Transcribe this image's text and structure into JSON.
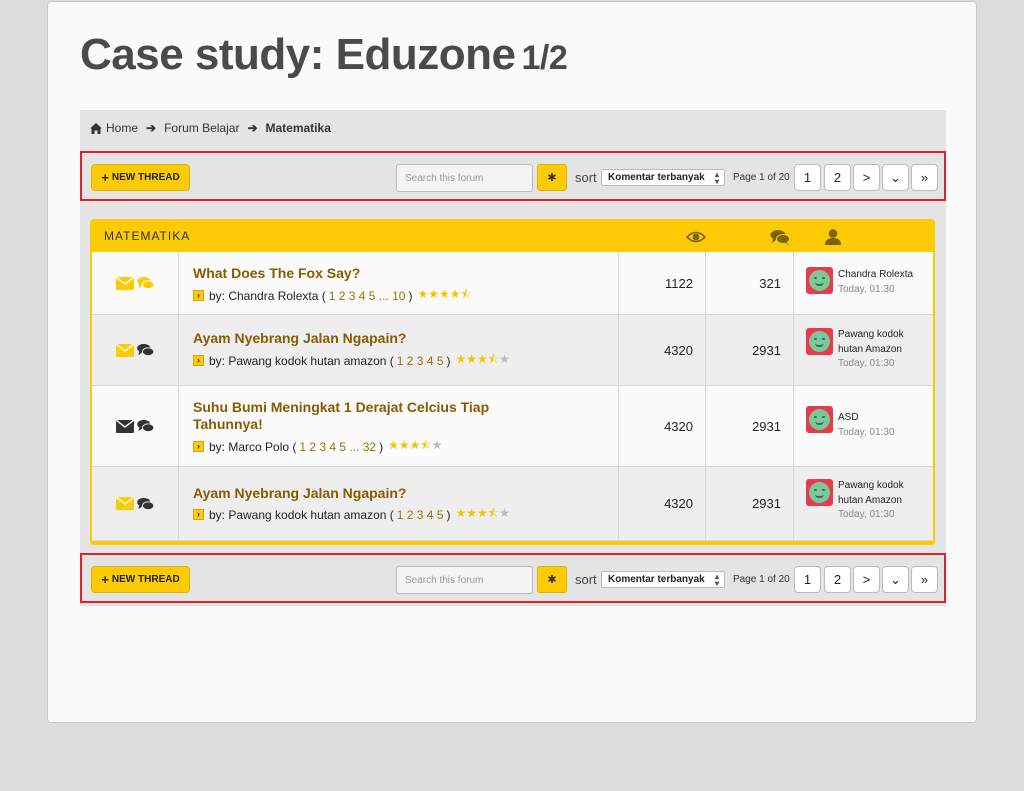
{
  "slide": {
    "title": "Case study: Eduzone",
    "title_num": "1/2"
  },
  "breadcrumb": {
    "home": "Home",
    "forum": "Forum Belajar",
    "current": "Matematika"
  },
  "toolbar": {
    "new_thread": "NEW THREAD",
    "search_placeholder": "Search this forum",
    "sort_label": "sort",
    "sort_value": "Komentar terbanyak",
    "page_info": "Page 1 of 20",
    "pages": [
      "1",
      "2"
    ],
    "next": ">",
    "dropdown": "⌄",
    "last": "»"
  },
  "panel": {
    "title": "MATEMATIKA",
    "icons": [
      "eye-icon",
      "comments-icon",
      "user-icon"
    ]
  },
  "threads": [
    {
      "title": "What Does The Fox Say?",
      "by": "by: Chandra Rolexta (",
      "pages": "1 2 3 4 5 ... 10",
      "close": ")",
      "rating": 4.5,
      "views": "1122",
      "replies": "321",
      "last_user": "Chandra Rolexta",
      "last_time": "Today, 01:30",
      "icon_color": "#fccb06",
      "comment_color": "#fccb06"
    },
    {
      "title": "Ayam Nyebrang Jalan Ngapain?",
      "by": "by: Pawang kodok hutan amazon (",
      "pages": "1 2 3 4 5",
      "close": ")",
      "rating": 3.5,
      "views": "4320",
      "replies": "2931",
      "last_user": "Pawang kodok hutan Amazon",
      "last_time": "Today, 01:30",
      "icon_color": "#fccb06",
      "comment_color": "#333333"
    },
    {
      "title": "Suhu Bumi Meningkat 1 Derajat Celcius Tiap Tahunnya!",
      "by": "by: Marco Polo (",
      "pages": "1 2 3 4 5 ... 32",
      "close": ")",
      "rating": 3.5,
      "views": "4320",
      "replies": "2931",
      "last_user": "ASD",
      "last_time": "Today, 01:30",
      "icon_color": "#333333",
      "comment_color": "#333333"
    },
    {
      "title": "Ayam Nyebrang Jalan Ngapain?",
      "by": "by: Pawang kodok hutan amazon (",
      "pages": "1 2 3 4 5",
      "close": ")",
      "rating": 3.5,
      "views": "4320",
      "replies": "2931",
      "last_user": "Pawang kodok hutan Amazon",
      "last_time": "Today, 01:30",
      "icon_color": "#fccb06",
      "comment_color": "#333333"
    }
  ],
  "colors": {
    "accent": "#fccb06",
    "highlight_border": "#e0222a",
    "thread_title": "#8a5a00"
  }
}
